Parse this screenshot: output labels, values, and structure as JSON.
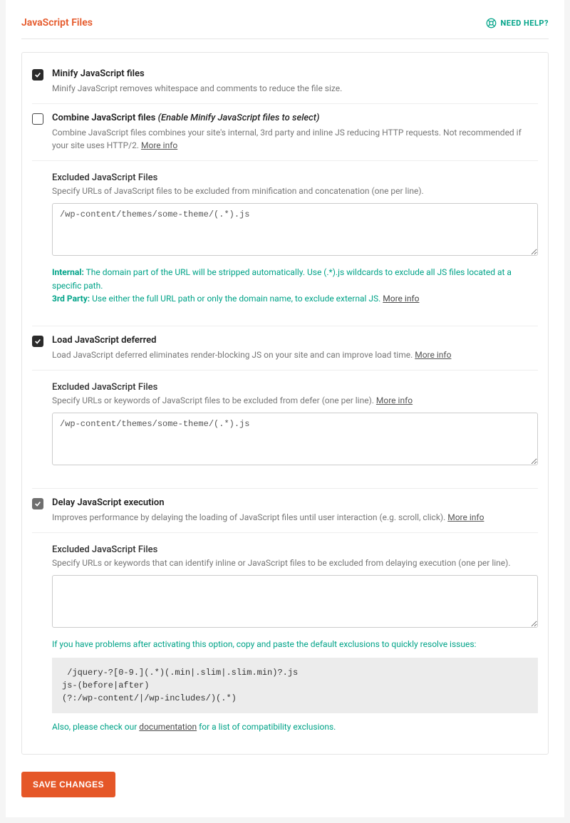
{
  "header": {
    "title": "JavaScript Files",
    "help": "NEED HELP?"
  },
  "minify": {
    "title": "Minify JavaScript files",
    "desc": "Minify JavaScript removes whitespace and comments to reduce the file size."
  },
  "combine": {
    "title": "Combine JavaScript files",
    "note": "(Enable Minify JavaScript files to select)",
    "desc_pre": "Combine JavaScript files combines your site's internal, 3rd party and inline JS reducing HTTP requests. Not recommended if your site uses HTTP/2. ",
    "more": "More info"
  },
  "excluded1": {
    "title": "Excluded JavaScript Files",
    "desc": "Specify URLs of JavaScript files to be excluded from minification and concatenation (one per line).",
    "value": "/wp-content/themes/some-theme/(.*).js",
    "hint_internal_label": "Internal:",
    "hint_internal_text": " The domain part of the URL will be stripped automatically. Use (.*).js wildcards to exclude all JS files located at a specific path.",
    "hint_3rd_label": "3rd Party:",
    "hint_3rd_text": " Use either the full URL path or only the domain name, to exclude external JS. ",
    "hint_more": "More info"
  },
  "defer": {
    "title": "Load JavaScript deferred",
    "desc_pre": "Load JavaScript deferred eliminates render-blocking JS on your site and can improve load time. ",
    "more": "More info"
  },
  "excluded2": {
    "title": "Excluded JavaScript Files",
    "desc_pre": "Specify URLs or keywords of JavaScript files to be excluded from defer (one per line). ",
    "more": "More info",
    "value": "/wp-content/themes/some-theme/(.*).js"
  },
  "delay": {
    "title": "Delay JavaScript execution",
    "desc_pre": "Improves performance by delaying the loading of JavaScript files until user interaction (e.g. scroll, click). ",
    "more": "More info"
  },
  "excluded3": {
    "title": "Excluded JavaScript Files",
    "desc": "Specify URLs or keywords that can identify inline or JavaScript files to be excluded from delaying execution (one per line).",
    "value": "",
    "problems_text": "If you have problems after activating this option, copy and paste the default exclusions to quickly resolve issues:",
    "code": " /jquery-?[0-9.](.*)(.min|.slim|.slim.min)?.js\njs-(before|after)\n(?:/wp-content/|/wp-includes/)(.*)",
    "also_pre": "Also, please check our ",
    "also_link": "documentation",
    "also_post": " for a list of compatibility exclusions."
  },
  "save": "SAVE CHANGES"
}
